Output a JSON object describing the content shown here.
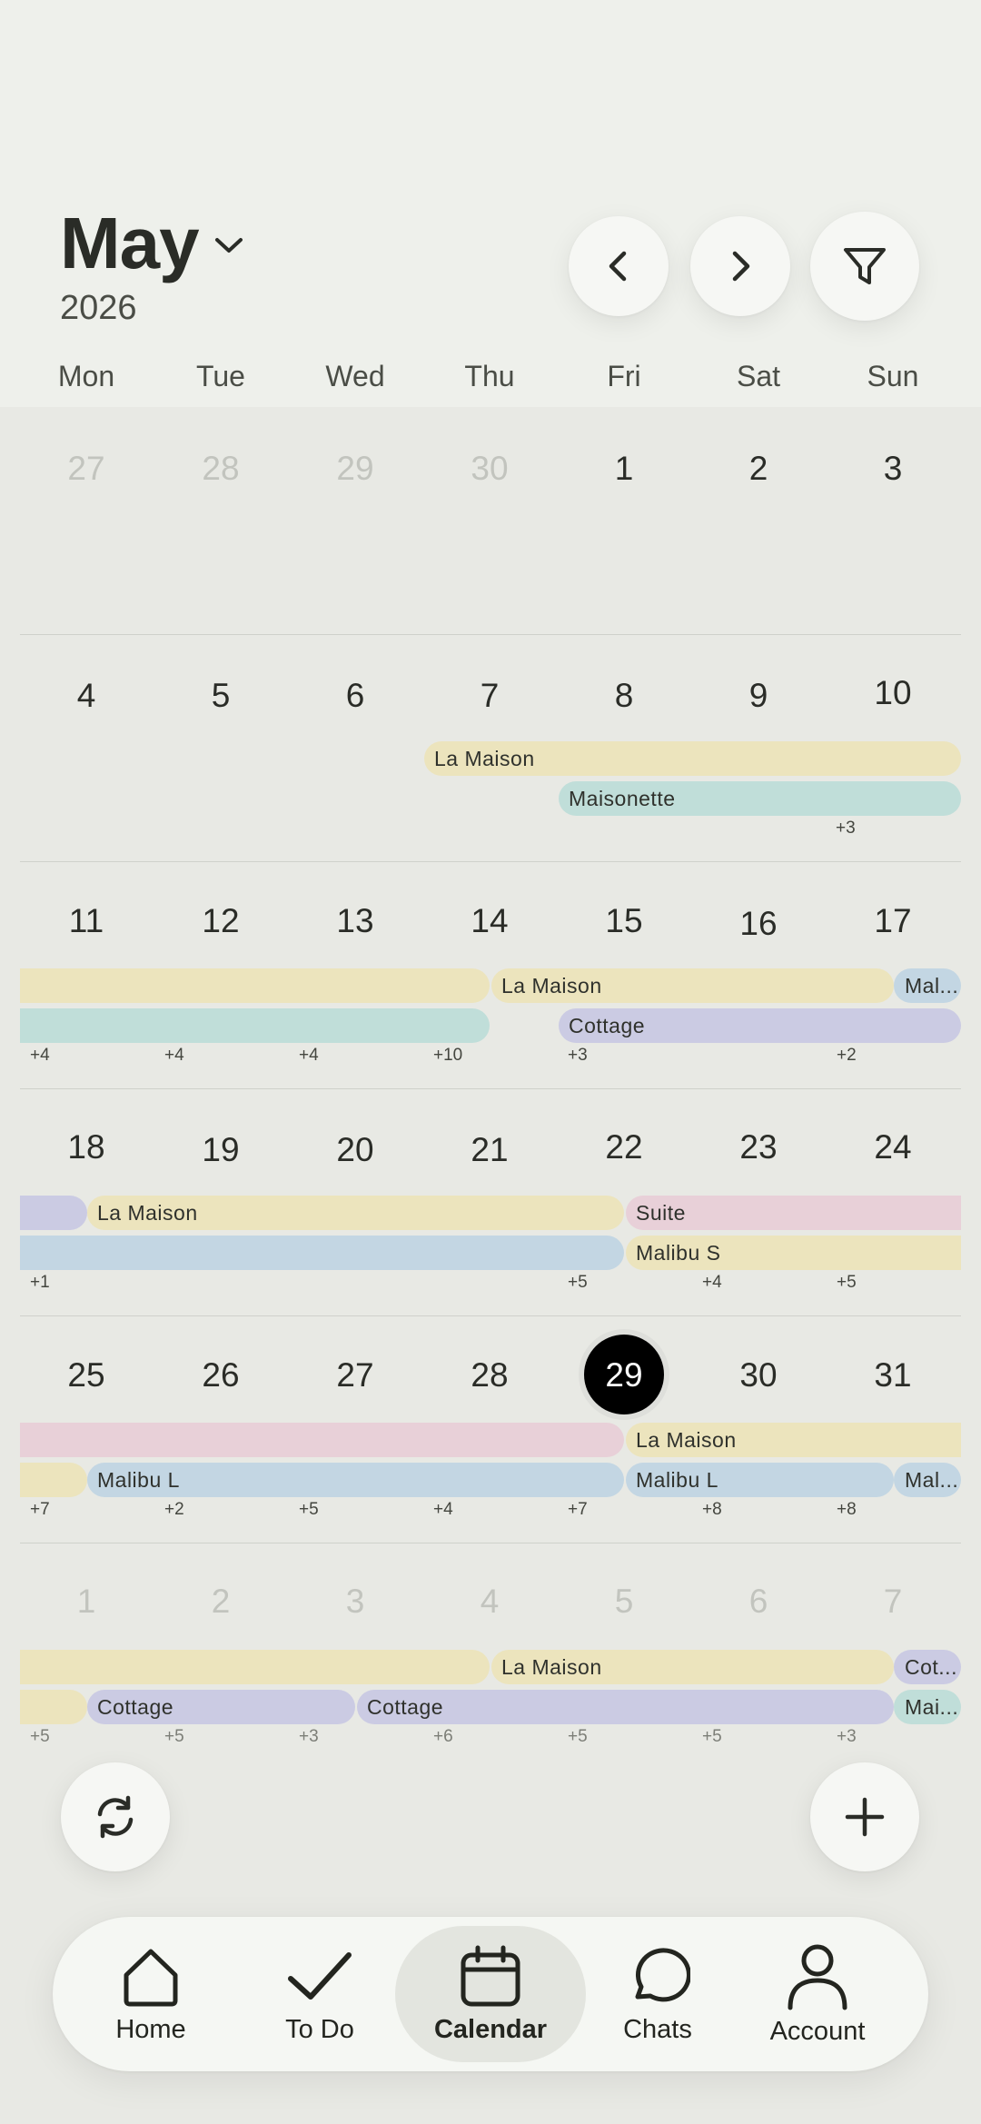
{
  "header": {
    "month": "May",
    "year": "2026"
  },
  "weekdays": [
    "Mon",
    "Tue",
    "Wed",
    "Thu",
    "Fri",
    "Sat",
    "Sun"
  ],
  "weeks": [
    {
      "days": [
        "27",
        "28",
        "29",
        "30",
        "1",
        "2",
        "3"
      ],
      "more": [
        "",
        "",
        "",
        "",
        "",
        "",
        ""
      ]
    },
    {
      "days": [
        "4",
        "5",
        "6",
        "7",
        "8",
        "9",
        "10"
      ],
      "more": [
        "",
        "",
        "",
        "",
        "",
        "",
        "+3"
      ]
    },
    {
      "days": [
        "11",
        "12",
        "13",
        "14",
        "15",
        "16",
        "17"
      ],
      "more": [
        "+4",
        "+4",
        "+4",
        "+10",
        "+3",
        "",
        "+2"
      ]
    },
    {
      "days": [
        "18",
        "19",
        "20",
        "21",
        "22",
        "23",
        "24"
      ],
      "more": [
        "+1",
        "",
        "",
        "",
        "+5",
        "+4",
        "+5"
      ]
    },
    {
      "days": [
        "25",
        "26",
        "27",
        "28",
        "29",
        "30",
        "31"
      ],
      "more": [
        "+7",
        "+2",
        "+5",
        "+4",
        "+7",
        "+8",
        "+8"
      ]
    },
    {
      "days": [
        "1",
        "2",
        "3",
        "4",
        "5",
        "6",
        "7"
      ],
      "more": [
        "+5",
        "+5",
        "+3",
        "+6",
        "+5",
        "+5",
        "+3"
      ]
    }
  ],
  "events": {
    "la_maison": "La Maison",
    "maisonette": "Maisonette",
    "cottage": "Cottage",
    "suite": "Suite",
    "malibu_s": "Malibu S",
    "malibu_l": "Malibu L",
    "mal_trunc": "Mal...",
    "cot_trunc": "Cot...",
    "mai_trunc": "Mai..."
  },
  "colors": {
    "yellow": "#ece4bd",
    "teal": "#c0ded9",
    "lavender": "#cbcbe3",
    "pink": "#e8d0d8",
    "blue": "#c3d6e3"
  },
  "nav": {
    "home": "Home",
    "todo": "To Do",
    "calendar": "Calendar",
    "chats": "Chats",
    "account": "Account"
  }
}
